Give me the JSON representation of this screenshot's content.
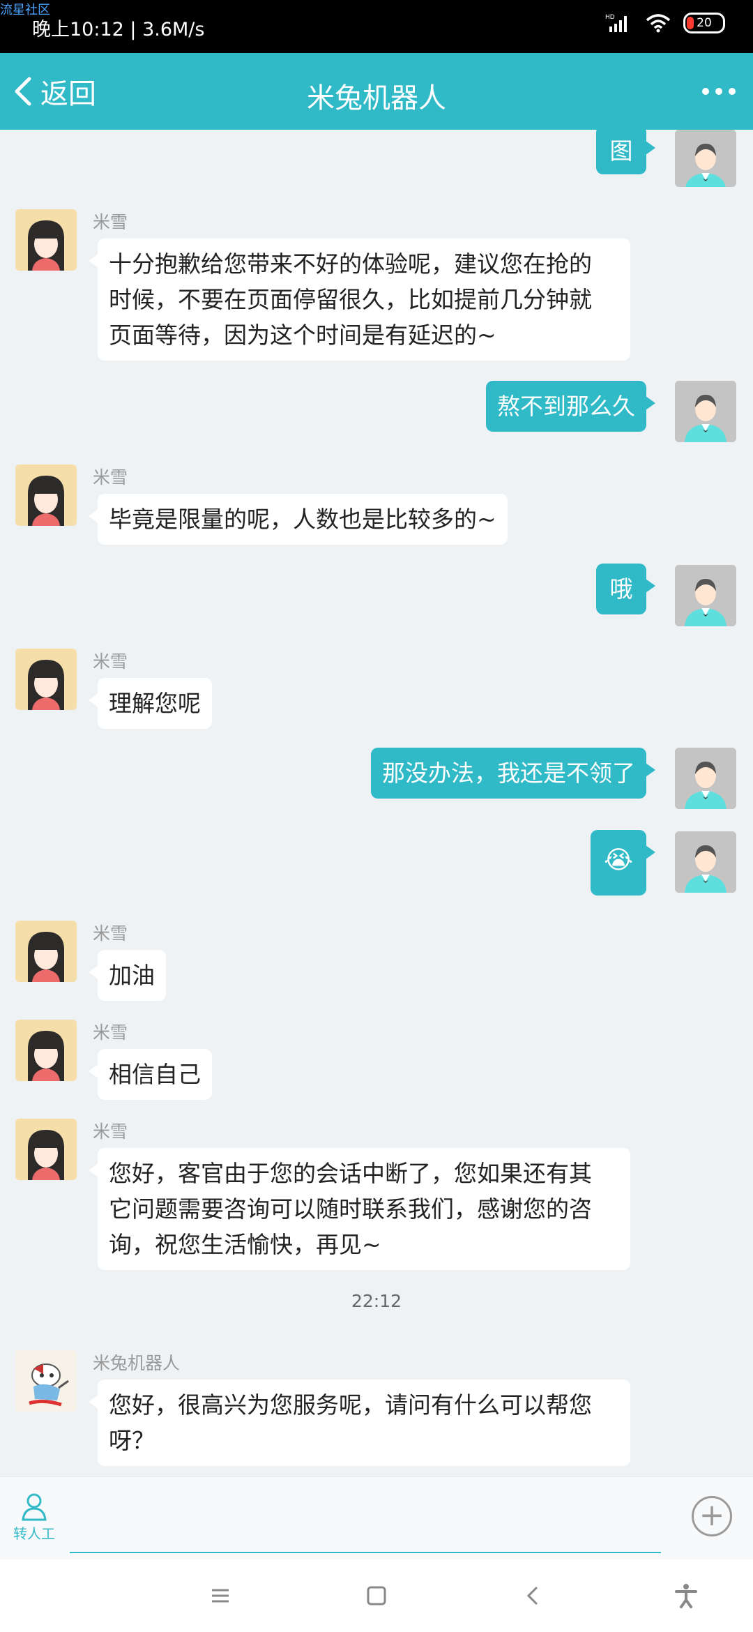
{
  "status_bar": {
    "watermark": "流星社区",
    "time_speed": "晚上10:12 | 3.6M/s",
    "hd_label": "HD",
    "battery": "20",
    "battery_color": "#ff3b30"
  },
  "header": {
    "back_label": "返回",
    "title": "米兔机器人",
    "more_icon": "more-dots-icon",
    "accent_color": "#30b9c6"
  },
  "messages": [
    {
      "side": "right",
      "text": "图"
    },
    {
      "side": "left",
      "sender": "米雪",
      "text_lines": [
        "十分抱歉给您带来不好的体验呢，建议您在抢的",
        "时候，不要在页面停留很久，比如提前几分钟就",
        "页面等待，因为这个时间是有延迟的~"
      ]
    },
    {
      "side": "right",
      "text": "熬不到那么久"
    },
    {
      "side": "left",
      "sender": "米雪",
      "text": "毕竟是限量的呢，人数也是比较多的~"
    },
    {
      "side": "right",
      "text": "哦"
    },
    {
      "side": "left",
      "sender": "米雪",
      "text": "理解您呢"
    },
    {
      "side": "right",
      "text": "那没办法，我还是不领了"
    },
    {
      "side": "right",
      "emoji": "😭"
    },
    {
      "side": "left",
      "sender": "米雪",
      "text": "加油"
    },
    {
      "side": "left",
      "sender": "米雪",
      "text": "相信自己"
    },
    {
      "side": "left",
      "sender": "米雪",
      "text_lines": [
        "您好，客官由于您的会话中断了，您如果还有其",
        "它问题需要咨询可以随时联系我们，感谢您的咨",
        "询，祝您生活愉快，再见~"
      ]
    },
    {
      "timestamp": "22:12"
    },
    {
      "side": "left",
      "sender": "米兔机器人",
      "text_lines": [
        "您好，很高兴为您服务呢，请问有什么可以帮您",
        "呀？"
      ]
    }
  ],
  "input_bar": {
    "transfer_label": "转人工",
    "transfer_icon": "person-icon",
    "plus_icon": "plus-circle-icon"
  },
  "nav_bar": {
    "icons": [
      "menu-icon",
      "home-square-icon",
      "back-chevron-icon",
      "accessibility-icon"
    ]
  }
}
